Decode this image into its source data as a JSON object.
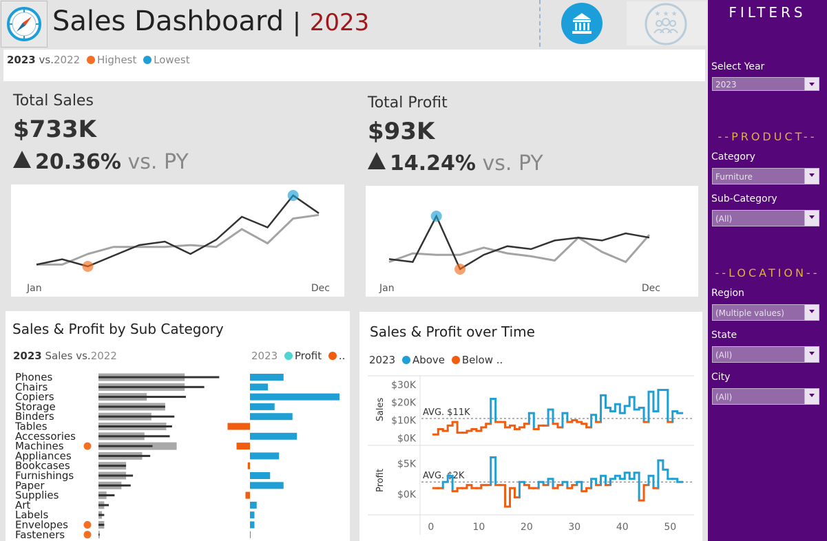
{
  "header": {
    "title": "Sales Dashboard",
    "separator": "|",
    "year": "2023"
  },
  "legend": {
    "current_year": "2023",
    "vs": "vs.",
    "prior_year": "2022",
    "highest": "Highest",
    "lowest": "Lowest"
  },
  "colors": {
    "highest": "#f36f21",
    "lowest": "#1f9fd4",
    "sidebar": "#55077a",
    "section_heading": "#e0b23a",
    "above": "#1f9fd4",
    "below": "#f25c0f",
    "profit_legend": "#4fd6d0",
    "title_year": "#a0171c"
  },
  "icons": [
    "compass-icon",
    "bank-icon",
    "people-group-icon"
  ],
  "kpis": {
    "sales": {
      "title": "Total Sales",
      "value": "$733K",
      "change": "20.36%",
      "vs_label": "vs. PY"
    },
    "profit": {
      "title": "Total Profit",
      "value": "$93K",
      "change": "14.24%",
      "vs_label": "vs. PY"
    }
  },
  "sparklines": {
    "start_label": "Jan",
    "end_label": "Dec",
    "sales": {
      "current": [
        4,
        7,
        3,
        9,
        15,
        17,
        10,
        18,
        31,
        25,
        43,
        33
      ],
      "prior": [
        4,
        4,
        10,
        14,
        14,
        14,
        15,
        14,
        24,
        16,
        30,
        32
      ],
      "max_index": 10,
      "min_index": 2
    },
    "profit": {
      "current": [
        10,
        8,
        40,
        3,
        13,
        19,
        17,
        23,
        25,
        23,
        28,
        25
      ],
      "prior": [
        8,
        14,
        13,
        13,
        18,
        14,
        12,
        9,
        25,
        15,
        8,
        27
      ],
      "max_index": 2,
      "min_index": 3
    }
  },
  "subcat_panel": {
    "title": "Sales & Profit by Sub Category",
    "left_legend": {
      "current": "2023",
      "label": "Sales vs.",
      "prior": "2022"
    },
    "right_legend": {
      "current": "2023",
      "profit": "Profit",
      "truncated": ".."
    },
    "chart_data": {
      "type": "bar",
      "categories": [
        "Phones",
        "Chairs",
        "Copiers",
        "Storage",
        "Binders",
        "Tables",
        "Accessories",
        "Machines",
        "Appliances",
        "Bookcases",
        "Furnishings",
        "Paper",
        "Supplies",
        "Art",
        "Labels",
        "Envelopes",
        "Fasteners"
      ],
      "series": [
        {
          "name": "2023",
          "values": [
            105,
            92,
            76,
            58,
            66,
            64,
            62,
            47,
            45,
            24,
            30,
            28,
            14,
            9,
            5,
            5,
            1
          ]
        },
        {
          "name": "2022",
          "values": [
            75,
            75,
            42,
            58,
            46,
            59,
            40,
            68,
            38,
            24,
            24,
            20,
            7,
            5,
            3,
            5,
            1
          ]
        },
        {
          "name": "Profit",
          "values": [
            15,
            8,
            40,
            11,
            19,
            -10,
            21,
            -6,
            13,
            -1,
            9,
            15,
            -2,
            3,
            2,
            2,
            0
          ]
        }
      ],
      "marked": [
        7,
        15,
        16
      ]
    }
  },
  "time_panel": {
    "title": "Sales & Profit over Time",
    "legend": {
      "year": "2023",
      "above": "Above",
      "below": "Below .."
    },
    "chart_data": {
      "type": "line",
      "x": [
        1,
        2,
        3,
        4,
        5,
        6,
        7,
        8,
        9,
        10,
        11,
        12,
        13,
        14,
        15,
        16,
        17,
        18,
        19,
        20,
        21,
        22,
        23,
        24,
        25,
        26,
        27,
        28,
        29,
        30,
        31,
        32,
        33,
        34,
        35,
        36,
        37,
        38,
        39,
        40,
        41,
        42,
        43,
        44,
        45,
        46,
        47,
        48,
        49,
        50,
        51,
        52
      ],
      "x_ticks": [
        0,
        10,
        20,
        30,
        40,
        50
      ],
      "xlim": [
        -2,
        55
      ],
      "sales": {
        "ylabel": "Sales",
        "ylim": [
          -1000,
          33000
        ],
        "ticks": [
          0,
          10000,
          20000,
          30000
        ],
        "tick_labels": [
          "$0K",
          "$10K",
          "$20K",
          "$30K"
        ],
        "avg": 11000,
        "avg_label": "AVG. $11K",
        "values": [
          2000,
          5000,
          4000,
          7000,
          9000,
          3000,
          3000,
          4000,
          5000,
          4000,
          6000,
          8000,
          22000,
          9000,
          9000,
          6000,
          7000,
          5000,
          6000,
          8000,
          14000,
          5000,
          7000,
          7000,
          16000,
          8000,
          6000,
          14000,
          9000,
          10000,
          9000,
          8000,
          6000,
          13000,
          9000,
          24000,
          17000,
          15000,
          19000,
          14000,
          18000,
          23000,
          16000,
          17000,
          9000,
          26000,
          15000,
          27000,
          27000,
          9000,
          15000,
          14000
        ]
      },
      "profit": {
        "ylabel": "Profit",
        "ylim": [
          -3000,
          7500
        ],
        "ticks": [
          0,
          5000
        ],
        "tick_labels": [
          "$0K",
          "$5K"
        ],
        "avg": 2000,
        "avg_label": "AVG. $2K",
        "values": [
          1000,
          1000,
          2000,
          3000,
          500,
          1000,
          1000,
          1500,
          1000,
          1000,
          1500,
          1500,
          6000,
          1500,
          1500,
          -2000,
          1000,
          -500,
          2000,
          1500,
          1000,
          1000,
          2000,
          1500,
          2500,
          1000,
          1500,
          2000,
          1000,
          1500,
          2000,
          500,
          1000,
          2500,
          1500,
          3000,
          1500,
          2500,
          3000,
          2500,
          3500,
          2500,
          3500,
          -1000,
          1500,
          3000,
          1000,
          5500,
          4000,
          2500,
          2500,
          2000
        ]
      }
    }
  },
  "filters": {
    "title": "FILTERS",
    "year": {
      "label": "Select Year",
      "value": "2023"
    },
    "product_heading": "--PRODUCT--",
    "category": {
      "label": "Category",
      "value": "Furniture"
    },
    "subcategory": {
      "label": "Sub-Category",
      "value": "(All)"
    },
    "location_heading": "--LOCATION--",
    "region": {
      "label": "Region",
      "value": "(Multiple values)"
    },
    "state": {
      "label": "State",
      "value": "(All)"
    },
    "city": {
      "label": "City",
      "value": "(All)"
    }
  }
}
